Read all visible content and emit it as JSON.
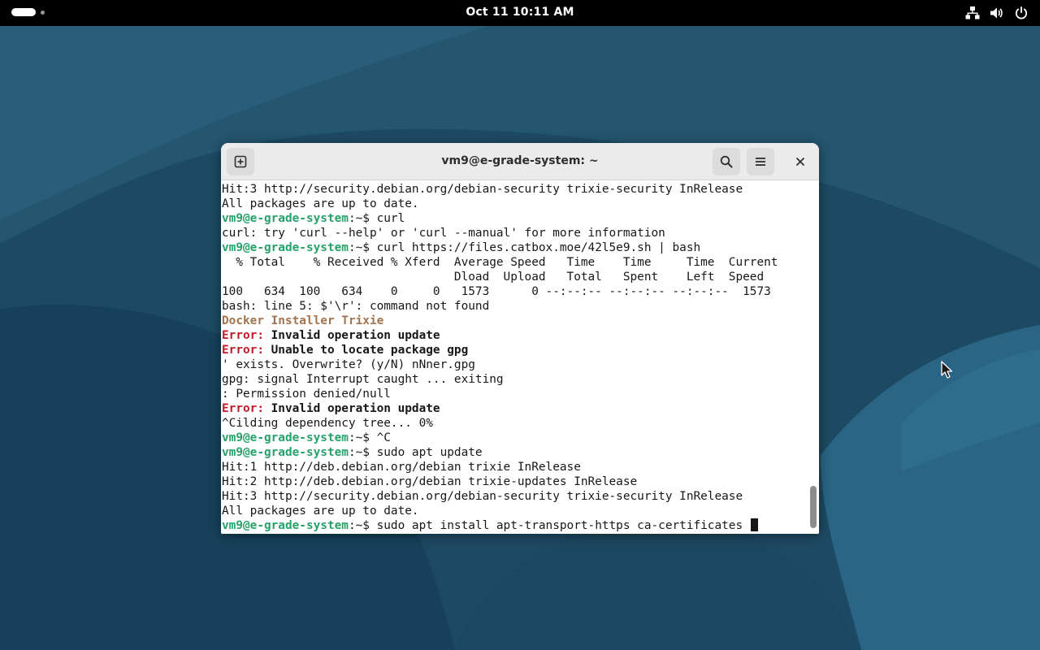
{
  "top_bar": {
    "clock": "Oct 11  10:11 AM",
    "tray_icons": [
      "network-icon",
      "volume-icon",
      "power-icon"
    ]
  },
  "terminal": {
    "title": "vm9@e-grade-system: ~",
    "buttons": [
      "new-tab-icon",
      "search-icon",
      "menu-icon",
      "close-icon"
    ],
    "lines": [
      [
        {
          "t": "Hit:3 http://security.debian.org/debian-security trixie-security InRelease",
          "s": ""
        }
      ],
      [
        {
          "t": "All packages are up to date.",
          "s": ""
        }
      ],
      [
        {
          "t": "vm9@e-grade-system",
          "s": "u"
        },
        {
          "t": ":~$ curl",
          "s": ""
        }
      ],
      [
        {
          "t": "curl: try 'curl --help' or 'curl --manual' for more information",
          "s": ""
        }
      ],
      [
        {
          "t": "vm9@e-grade-system",
          "s": "u"
        },
        {
          "t": ":~$ curl https://files.catbox.moe/42l5e9.sh | bash",
          "s": ""
        }
      ],
      [
        {
          "t": "  % Total    % Received % Xferd  Average Speed   Time    Time     Time  Current",
          "s": ""
        }
      ],
      [
        {
          "t": "                                 Dload  Upload   Total   Spent    Left  Speed",
          "s": ""
        }
      ],
      [
        {
          "t": "100   634  100   634    0     0   1573      0 --:--:-- --:--:-- --:--:--  1573",
          "s": ""
        }
      ],
      [
        {
          "t": "bash: line 5: $'\\r': command not found",
          "s": ""
        }
      ],
      [
        {
          "t": "Docker Installer Trixie",
          "s": "y"
        }
      ],
      [
        {
          "t": "Error:",
          "s": "e"
        },
        {
          "t": " Invalid operation update",
          "s": "b"
        }
      ],
      [
        {
          "t": "Error:",
          "s": "e"
        },
        {
          "t": " Unable to locate package gpg",
          "s": "b"
        }
      ],
      [
        {
          "t": "' exists. Overwrite? (y/N) nNner.gpg",
          "s": ""
        }
      ],
      [
        {
          "t": "gpg: signal Interrupt caught ... exiting",
          "s": ""
        }
      ],
      [
        {
          "t": ": Permission denied/null",
          "s": ""
        }
      ],
      [
        {
          "t": "Error:",
          "s": "e"
        },
        {
          "t": " Invalid operation update",
          "s": "b"
        }
      ],
      [
        {
          "t": "^Cilding dependency tree... 0%",
          "s": ""
        }
      ],
      [
        {
          "t": "vm9@e-grade-system",
          "s": "u"
        },
        {
          "t": ":~$ ^C",
          "s": ""
        }
      ],
      [
        {
          "t": "vm9@e-grade-system",
          "s": "u"
        },
        {
          "t": ":~$ sudo apt update",
          "s": ""
        }
      ],
      [
        {
          "t": "Hit:1 http://deb.debian.org/debian trixie InRelease",
          "s": ""
        }
      ],
      [
        {
          "t": "Hit:2 http://deb.debian.org/debian trixie-updates InRelease",
          "s": ""
        }
      ],
      [
        {
          "t": "Hit:3 http://security.debian.org/debian-security trixie-security InRelease",
          "s": ""
        }
      ],
      [
        {
          "t": "All packages are up to date.",
          "s": ""
        }
      ],
      [
        {
          "t": "vm9@e-grade-system",
          "s": "u"
        },
        {
          "t": ":~$ sudo apt install apt-transport-https ca-certificates ",
          "s": ""
        }
      ]
    ]
  },
  "colors": {
    "prompt_user": "#26a269",
    "error_label": "#c01c28",
    "installer_banner": "#a2734c",
    "topbar": "#000000",
    "desktop": "#1e4d66"
  }
}
